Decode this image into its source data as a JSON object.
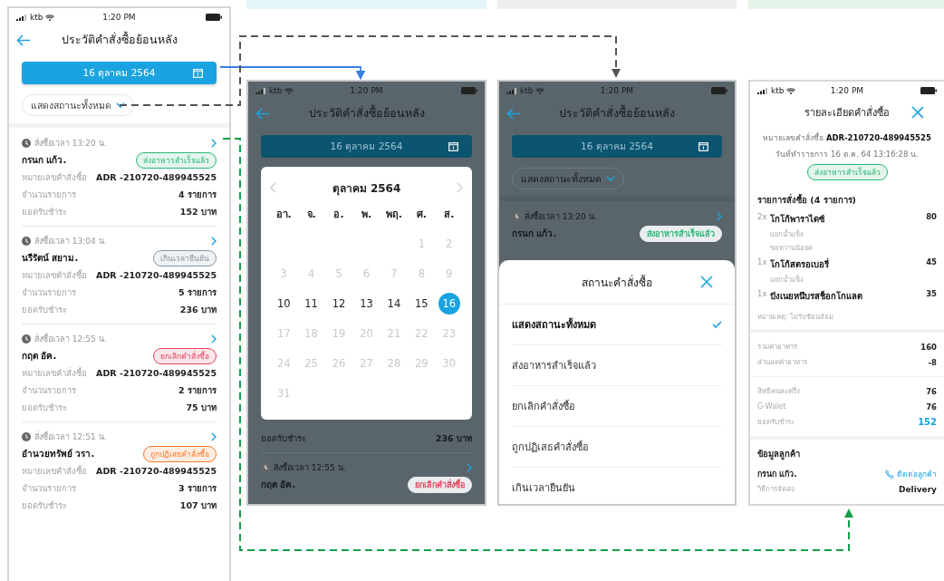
{
  "screens": [
    {
      "kind": "order_list",
      "status_bar": {
        "carrier": "ktb",
        "time": "1:20 PM"
      },
      "title": "ประวัติคำสั่งซื้อย้อนหลัง",
      "date_button": "16 ตุลาคม 2564",
      "filter": "แสดงสถานะทั้งหมด",
      "orders": [
        {
          "time": "สั่งซื้อเวลา 13:20 น.",
          "name": "กรนก แก้ว.",
          "status": "ส่งอาหารสำเร็จแล้ว",
          "color": "#2bb673",
          "rows": [
            {
              "label": "หมายเลขคำสั่งซื้อ",
              "value": "**ADR** -210720-489945525"
            },
            {
              "label": "จำนวนรายการ",
              "value": "4 รายการ"
            },
            {
              "label": "ยอดรับชำระ",
              "value": "152 บาท"
            }
          ]
        },
        {
          "time": "สั่งซื้อเวลา 13:04 น.",
          "name": "นรีรัตน์ สยาม.",
          "status": "เกินเวลายืนยัน",
          "color": "#8595a3",
          "rows": [
            {
              "label": "หมายเลขคำสั่งซื้อ",
              "value": "**ADR** -210720-489945525"
            },
            {
              "label": "จำนวนรายการ",
              "value": "5 รายการ"
            },
            {
              "label": "ยอดรับชำระ",
              "value": "236 บาท"
            }
          ]
        },
        {
          "time": "สั่งซื้อเวลา 12:55 น.",
          "name": "กฤต อัค.",
          "status": "ยกเลิกคำสั่งซื้อ",
          "color": "#e0455f",
          "rows": [
            {
              "label": "หมายเลขคำสั่งซื้อ",
              "value": "**ADR** -210720-489945525"
            },
            {
              "label": "จำนวนรายการ",
              "value": "2 รายการ"
            },
            {
              "label": "ยอดรับชำระ",
              "value": "75 บาท"
            }
          ]
        },
        {
          "time": "สั่งซื้อเวลา 12:51 น.",
          "name": "อำนวยทรัพย์ วรา.",
          "status": "ถูกปฏิเสธคำสั่งซื้อ",
          "color": "#f47b2a",
          "rows": [
            {
              "label": "หมายเลขคำสั่งซื้อ",
              "value": "**ADR** -210720-489945525"
            },
            {
              "label": "จำนวนรายการ",
              "value": "3 รายการ"
            },
            {
              "label": "ยอดรับชำระ",
              "value": "107 บาท"
            }
          ]
        }
      ]
    },
    {
      "kind": "calendar",
      "status_bar": {
        "carrier": "ktb",
        "time": "1:20 PM"
      },
      "title": "ประวัติคำสั่งซื้อย้อนหลัง",
      "date_button": "16 ตุลาคม 2564",
      "summary_row": {
        "label": "ยอดรับชำระ",
        "value": "236 บาท"
      },
      "orders": [
        {
          "time": "สั่งซื้อเวลา 12:55 น.",
          "name": "กฤต อัค.",
          "status": "ยกเลิกคำสั่งซื้อ",
          "color": "#e0455f"
        }
      ],
      "calendar": {
        "month": "ตุลาคม 2564",
        "weekdays": [
          "อา.",
          "จ.",
          "อ.",
          "พ.",
          "พฤ.",
          "ศ.",
          "ส."
        ],
        "days": [
          {
            "kind": "blank"
          },
          {
            "kind": "blank"
          },
          {
            "kind": "blank"
          },
          {
            "kind": "blank"
          },
          {
            "kind": "blank"
          },
          {
            "kind": "day",
            "label": "1",
            "enabled": false,
            "selected": false
          },
          {
            "kind": "day",
            "label": "2",
            "enabled": false,
            "selected": false
          },
          {
            "kind": "day",
            "label": "3",
            "enabled": false,
            "selected": false
          },
          {
            "kind": "day",
            "label": "4",
            "enabled": false,
            "selected": false
          },
          {
            "kind": "day",
            "label": "5",
            "enabled": false,
            "selected": false
          },
          {
            "kind": "day",
            "label": "6",
            "enabled": false,
            "selected": false
          },
          {
            "kind": "day",
            "label": "7",
            "enabled": false,
            "selected": false
          },
          {
            "kind": "day",
            "label": "8",
            "enabled": false,
            "selected": false
          },
          {
            "kind": "day",
            "label": "9",
            "enabled": false,
            "selected": false
          },
          {
            "kind": "day",
            "label": "10",
            "enabled": true,
            "selected": false
          },
          {
            "kind": "day",
            "label": "11",
            "enabled": true,
            "selected": false
          },
          {
            "kind": "day",
            "label": "12",
            "enabled": true,
            "selected": false
          },
          {
            "kind": "day",
            "label": "13",
            "enabled": true,
            "selected": false
          },
          {
            "kind": "day",
            "label": "14",
            "enabled": true,
            "selected": false
          },
          {
            "kind": "day",
            "label": "15",
            "enabled": true,
            "selected": false
          },
          {
            "kind": "day",
            "label": "16",
            "enabled": true,
            "selected": true
          },
          {
            "kind": "day",
            "label": "17",
            "enabled": false,
            "selected": false
          },
          {
            "kind": "day",
            "label": "18",
            "enabled": false,
            "selected": false
          },
          {
            "kind": "day",
            "label": "19",
            "enabled": false,
            "selected": false
          },
          {
            "kind": "day",
            "label": "20",
            "enabled": false,
            "selected": false
          },
          {
            "kind": "day",
            "label": "21",
            "enabled": false,
            "selected": false
          },
          {
            "kind": "day",
            "label": "22",
            "enabled": false,
            "selected": false
          },
          {
            "kind": "day",
            "label": "23",
            "enabled": false,
            "selected": false
          },
          {
            "kind": "day",
            "label": "24",
            "enabled": false,
            "selected": false
          },
          {
            "kind": "day",
            "label": "25",
            "enabled": false,
            "selected": false
          },
          {
            "kind": "day",
            "label": "26",
            "enabled": false,
            "selected": false
          },
          {
            "kind": "day",
            "label": "27",
            "enabled": false,
            "selected": false
          },
          {
            "kind": "day",
            "label": "28",
            "enabled": false,
            "selected": false
          },
          {
            "kind": "day",
            "label": "29",
            "enabled": false,
            "selected": false
          },
          {
            "kind": "day",
            "label": "30",
            "enabled": false,
            "selected": false
          },
          {
            "kind": "day",
            "label": "31",
            "enabled": false,
            "selected": false
          }
        ]
      }
    },
    {
      "kind": "status_sheet",
      "status_bar": {
        "carrier": "ktb",
        "time": "1:20 PM"
      },
      "title": "ประวัติคำสั่งซื้อย้อนหลัง",
      "date_button": "16 ตุลาคม 2564",
      "filter": "แสดงสถานะทั้งหมด",
      "orders": [
        {
          "time": "สั่งซื้อเวลา 13:20 น.",
          "name": "กรนก แก้ว.",
          "status": "ส่งอาหารสำเร็จแล้ว",
          "color": "#2bb673"
        }
      ],
      "sheet": {
        "title": "สถานะคำสั่งซื้อ",
        "options": [
          {
            "label": "แสดงสถานะทั้งหมด",
            "selected": true
          },
          {
            "label": "ส่งอาหารสำเร็จแล้ว",
            "selected": false
          },
          {
            "label": "ยกเลิกคำสั่งซื้อ",
            "selected": false
          },
          {
            "label": "ถูกปฏิเสธคำสั่งซื้อ",
            "selected": false
          },
          {
            "label": "เกินเวลายืนยัน",
            "selected": false
          }
        ]
      }
    },
    {
      "kind": "order_detail",
      "status_bar": {
        "carrier": "ktb",
        "time": "1:20 PM"
      },
      "title": "รายละเอียดคำสั่งซื้อ",
      "order_number": "หมายเลขคำสั่งซื้อ **ADR-210720-489945525**",
      "order_date": "วันที่ทำรายการ 16 ต.ค. 64 13:16:28 น.",
      "status": "ส่งอาหารสำเร็จแล้ว",
      "color": "#2bb673",
      "items_heading": "รายการสั่งซื้อ (4 รายการ)",
      "items": [
        {
          "qty": "2x",
          "name": "โกโก้พาราไดซ์",
          "price": "80",
          "notes": [
            "แยกน้ำแข็ง",
            "ขอหวานน้อยค"
          ]
        },
        {
          "qty": "1x",
          "name": "โกโก้สตรอเบอรี่",
          "price": "45",
          "notes": [
            "แยกน้ำแข็ง"
          ]
        },
        {
          "qty": "1x",
          "name": "ปังเนยหนึบรสช็อกโกแลต",
          "price": "35"
        }
      ],
      "remark": "หมายเหตุ: ไม่รับช้อนส้อม",
      "totals": [
        {
          "label": "รวมค่าอาหาร",
          "value": "160"
        },
        {
          "label": "ส่วนลดค่าอาหาร",
          "value": "-8"
        }
      ],
      "payments": [
        {
          "label": "สิทธิคนละครึ่ง",
          "value": "76",
          "emphasized": false
        },
        {
          "label": "G-Walet",
          "value": "76",
          "emphasized": false
        },
        {
          "label": "ยอดรับชำระ",
          "value": "152",
          "emphasized": true
        }
      ],
      "customer": {
        "heading": "ข้อมูลลูกค้า",
        "name": "กรนก แก้ว.",
        "contact": "ติดต่อลูกค้า",
        "shipping_label": "วิธีการจัดส่ง",
        "shipping_value": "Delivery"
      }
    }
  ]
}
